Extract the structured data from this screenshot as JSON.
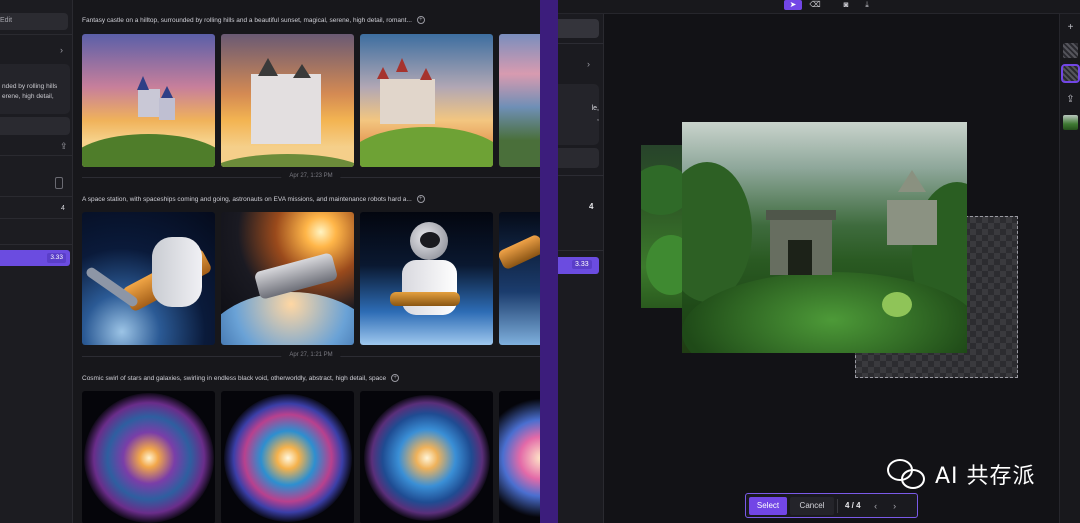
{
  "left_window": {
    "sidebar": {
      "edit_label": "Edit",
      "prompt_excerpt": "nded by rolling hills\nerene, high detail,",
      "count_value": "4",
      "slider_value": "3.33"
    },
    "feed": [
      {
        "prompt": "Fantasy castle on a hilltop, surrounded by rolling hills and a beautiful sunset, magical, serene, high detail, romant...",
        "timestamp_after": "Apr 27, 1:23 PM",
        "images": [
          "castle-sunset-1",
          "castle-sunset-2",
          "castle-sunset-3",
          "castle-sunset-4"
        ]
      },
      {
        "prompt": "A space station, with spaceships coming and going, astronauts on EVA missions, and maintenance robots hard a...",
        "timestamp_after": "Apr 27, 1:21 PM",
        "images": [
          "space-station-1",
          "space-station-2",
          "astronaut-eva-3",
          "space-station-4"
        ]
      },
      {
        "prompt": "Cosmic swirl of stars and galaxies, swirling in endless black void, otherworldly, abstract, high detail, space",
        "images": [
          "spiral-galaxy-1",
          "spiral-galaxy-2",
          "spiral-galaxy-3",
          "spiral-galaxy-4"
        ]
      }
    ]
  },
  "right_window": {
    "panel": {
      "prompt_excerpt": "le,\n,",
      "count_value": "4",
      "slider_value": "3.33"
    },
    "toolbar_icons": [
      "select-tool-icon",
      "eraser-icon",
      "camera-icon",
      "download-icon"
    ],
    "rightbar_icons": [
      "plus-icon",
      "layer-pattern-icon",
      "layer-pattern-active-icon",
      "upload-icon",
      "image-thumbnail"
    ],
    "bottom_bar": {
      "select_label": "Select",
      "cancel_label": "Cancel",
      "counter": "4 / 4",
      "prev_glyph": "‹",
      "next_glyph": "›"
    }
  },
  "watermark": {
    "text": "AI 共存派"
  },
  "colors": {
    "accent": "#7246e6",
    "divider": "#3c1d7c",
    "background": "#17171b"
  }
}
